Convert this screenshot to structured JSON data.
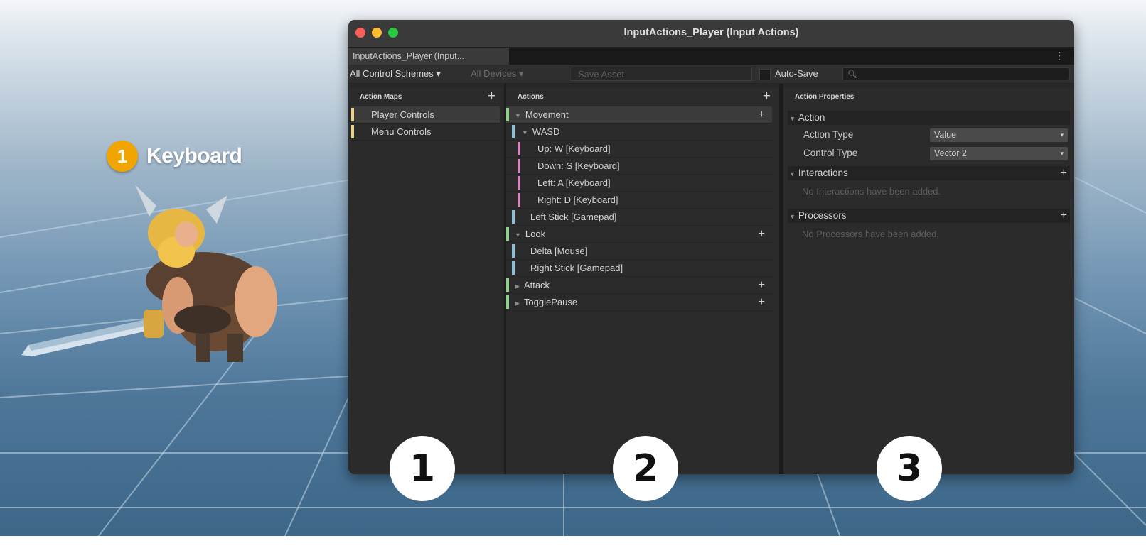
{
  "badge": {
    "number": "1",
    "label": "Keyboard"
  },
  "window": {
    "title": "InputActions_Player (Input Actions)",
    "tab_label": "InputActions_Player (Input...",
    "tab_menu": "⋮"
  },
  "toolbar": {
    "control_schemes": "All Control Schemes ▾",
    "devices": "All Devices     ▾",
    "save_asset": "Save Asset",
    "auto_save": "Auto-Save",
    "search_icon": "🔍︎"
  },
  "action_maps": {
    "header": "Action Maps",
    "plus": "+",
    "items": [
      {
        "label": "Player Controls",
        "color": "#e8d38a",
        "selected": true
      },
      {
        "label": "Menu Controls",
        "color": "#e8d38a",
        "selected": false
      }
    ]
  },
  "actions": {
    "header": "Actions",
    "plus": "+",
    "items": [
      {
        "label": "Movement",
        "tri": "▼",
        "indent": 0,
        "color": "#8fd18a",
        "plus": "+",
        "selected": true
      },
      {
        "label": "WASD",
        "tri": "▼",
        "indent": 1,
        "color": "#8cc0d6",
        "plus": "",
        "selected": false
      },
      {
        "label": "Up: W [Keyboard]",
        "tri": "",
        "indent": 2,
        "color": "#d08bbb",
        "plus": "",
        "selected": false
      },
      {
        "label": "Down: S [Keyboard]",
        "tri": "",
        "indent": 2,
        "color": "#d08bbb",
        "plus": "",
        "selected": false
      },
      {
        "label": "Left: A [Keyboard]",
        "tri": "",
        "indent": 2,
        "color": "#d08bbb",
        "plus": "",
        "selected": false
      },
      {
        "label": "Right: D [Keyboard]",
        "tri": "",
        "indent": 2,
        "color": "#d08bbb",
        "plus": "",
        "selected": false
      },
      {
        "label": "Left Stick [Gamepad]",
        "tri": "",
        "indent": 1,
        "color": "#8cc0d6",
        "plus": "",
        "selected": false
      },
      {
        "label": "Look",
        "tri": "▼",
        "indent": 0,
        "color": "#8fd18a",
        "plus": "+",
        "selected": false
      },
      {
        "label": "Delta [Mouse]",
        "tri": "",
        "indent": 1,
        "color": "#8cc0d6",
        "plus": "",
        "selected": false
      },
      {
        "label": "Right Stick [Gamepad]",
        "tri": "",
        "indent": 1,
        "color": "#8cc0d6",
        "plus": "",
        "selected": false
      },
      {
        "label": "Attack",
        "tri": "▶",
        "indent": 0,
        "color": "#8fd18a",
        "plus": "+",
        "selected": false
      },
      {
        "label": "TogglePause",
        "tri": "▶",
        "indent": 0,
        "color": "#8fd18a",
        "plus": "+",
        "selected": false
      }
    ]
  },
  "properties": {
    "header": "Action Properties",
    "action_section": "Action",
    "action_type_label": "Action Type",
    "action_type_value": "Value",
    "control_type_label": "Control Type",
    "control_type_value": "Vector 2",
    "interactions_section": "Interactions",
    "interactions_empty": "No Interactions have been added.",
    "processors_section": "Processors",
    "processors_empty": "No Processors have been added.",
    "plus": "+",
    "tri": "▼",
    "arrow": "▾"
  },
  "callouts": [
    "1",
    "2",
    "3"
  ]
}
